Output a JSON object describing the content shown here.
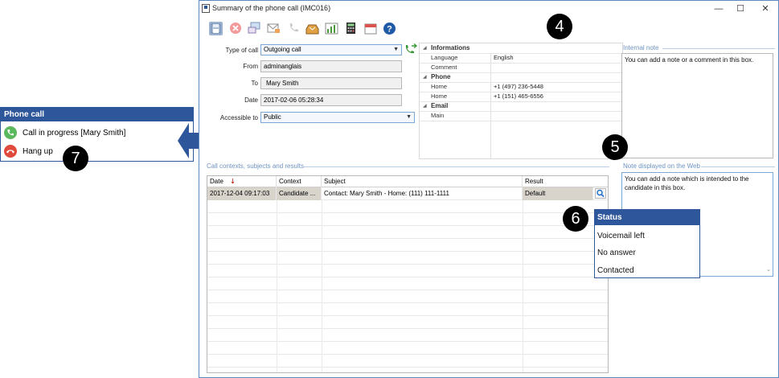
{
  "phone_panel": {
    "title": "Phone call",
    "call_in_progress_label": "Call in progress [Mary Smith]",
    "hang_up_label": "Hang up"
  },
  "callouts": {
    "four": "4",
    "five": "5",
    "six": "6",
    "seven": "7"
  },
  "window": {
    "title": "Summary of the phone call (IMC016)",
    "minimize": "—",
    "maximize": "☐",
    "close": "✕"
  },
  "toolbar": {
    "icons": [
      "save-icon",
      "cancel-icon",
      "transfer-icon",
      "email-icon",
      "phone-icon",
      "inbox-icon",
      "chart-icon",
      "calculator-icon",
      "calendar-icon",
      "help-icon"
    ]
  },
  "form": {
    "type_of_call_label": "Type of call",
    "type_of_call_value": "Outgoing call",
    "from_label": "From",
    "from_value": "adminanglais",
    "to_label": "To",
    "to_value": "Mary Smith",
    "date_label": "Date",
    "date_value": "2017-02-06 05:28:34",
    "accessible_label": "Accessible to",
    "accessible_value": "Public"
  },
  "properties": {
    "informations": "Informations",
    "language_key": "Language",
    "language_value": "English",
    "comment_key": "Comment",
    "phone": "Phone",
    "home1_key": "Home",
    "home1_value": "+1 (497) 236-5448",
    "home2_key": "Home",
    "home2_value": "+1 (151) 465-6556",
    "email": "Email",
    "main_key": "Main"
  },
  "internal_note": {
    "title": "Internal note",
    "text": "You can add a note or a comment in this box."
  },
  "web_note": {
    "title": "Note displayed on the Web",
    "text": "You can add a note which is intended to the candidate in this box."
  },
  "contexts": {
    "title": "Call contexts, subjects and results",
    "columns": {
      "date": "Date",
      "context": "Context",
      "subject": "Subject",
      "result": "Result"
    },
    "row": {
      "date": "2017-12-04 09:17:03",
      "context": "Candidate ...",
      "subject": "Contact: Mary Smith - Home: (111) 111-1111",
      "result": "Default"
    }
  },
  "status_popup": {
    "title": "Status",
    "options": [
      "Voicemail left",
      "No answer",
      "Contacted"
    ]
  }
}
